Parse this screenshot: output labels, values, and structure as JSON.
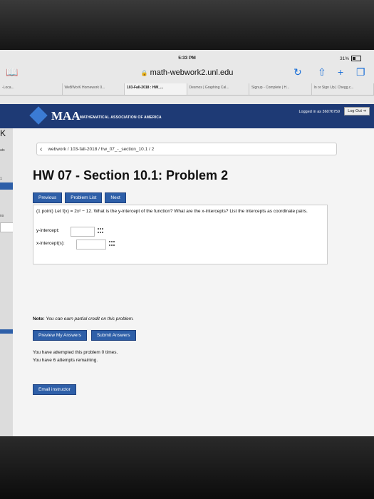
{
  "status": {
    "time": "5:33 PM",
    "battery": "31%"
  },
  "browser": {
    "url": "math-webwork2.unl.edu"
  },
  "tabs": [
    "-Loca...",
    "WeBWorK Homework 0...",
    "103-Fall-2018 : HW_...",
    "Desmos | Graphing Cal...",
    "Signup - Complete | H...",
    "In or Sign Up | Chegg.c..."
  ],
  "header": {
    "logo": "MAA",
    "subtitle": "MATHEMATICAL ASSOCIATION OF AMERICA",
    "logged_in": "Logged in as 36076759",
    "logout": "Log Out"
  },
  "sidebar": {
    "letter": "K",
    "items": [
      "ats",
      "1",
      "ns"
    ]
  },
  "breadcrumb": "webwork / 103-fall-2018 / hw_07_-_section_10.1 / 2",
  "title": "HW 07 - Section 10.1: Problem 2",
  "nav_buttons": {
    "previous": "Previous",
    "problem_list": "Problem List",
    "next": "Next"
  },
  "problem": {
    "text": "(1 point) Let f(x) = 2x² − 12. What is the y-intercept of the function? What are the x-intercepts? List the intercepts as coordinate pairs.",
    "y_label": "y-intercept:",
    "x_label": "x-intercept(s):",
    "y_value": "",
    "x_value": ""
  },
  "note": {
    "label": "Note:",
    "text": "You can earn partial credit on this problem."
  },
  "action_buttons": {
    "preview": "Preview My Answers",
    "submit": "Submit Answers"
  },
  "attempts": {
    "line1": "You have attempted this problem 0 times.",
    "line2": "You have 6 attempts remaining."
  },
  "email": "Email instructor"
}
